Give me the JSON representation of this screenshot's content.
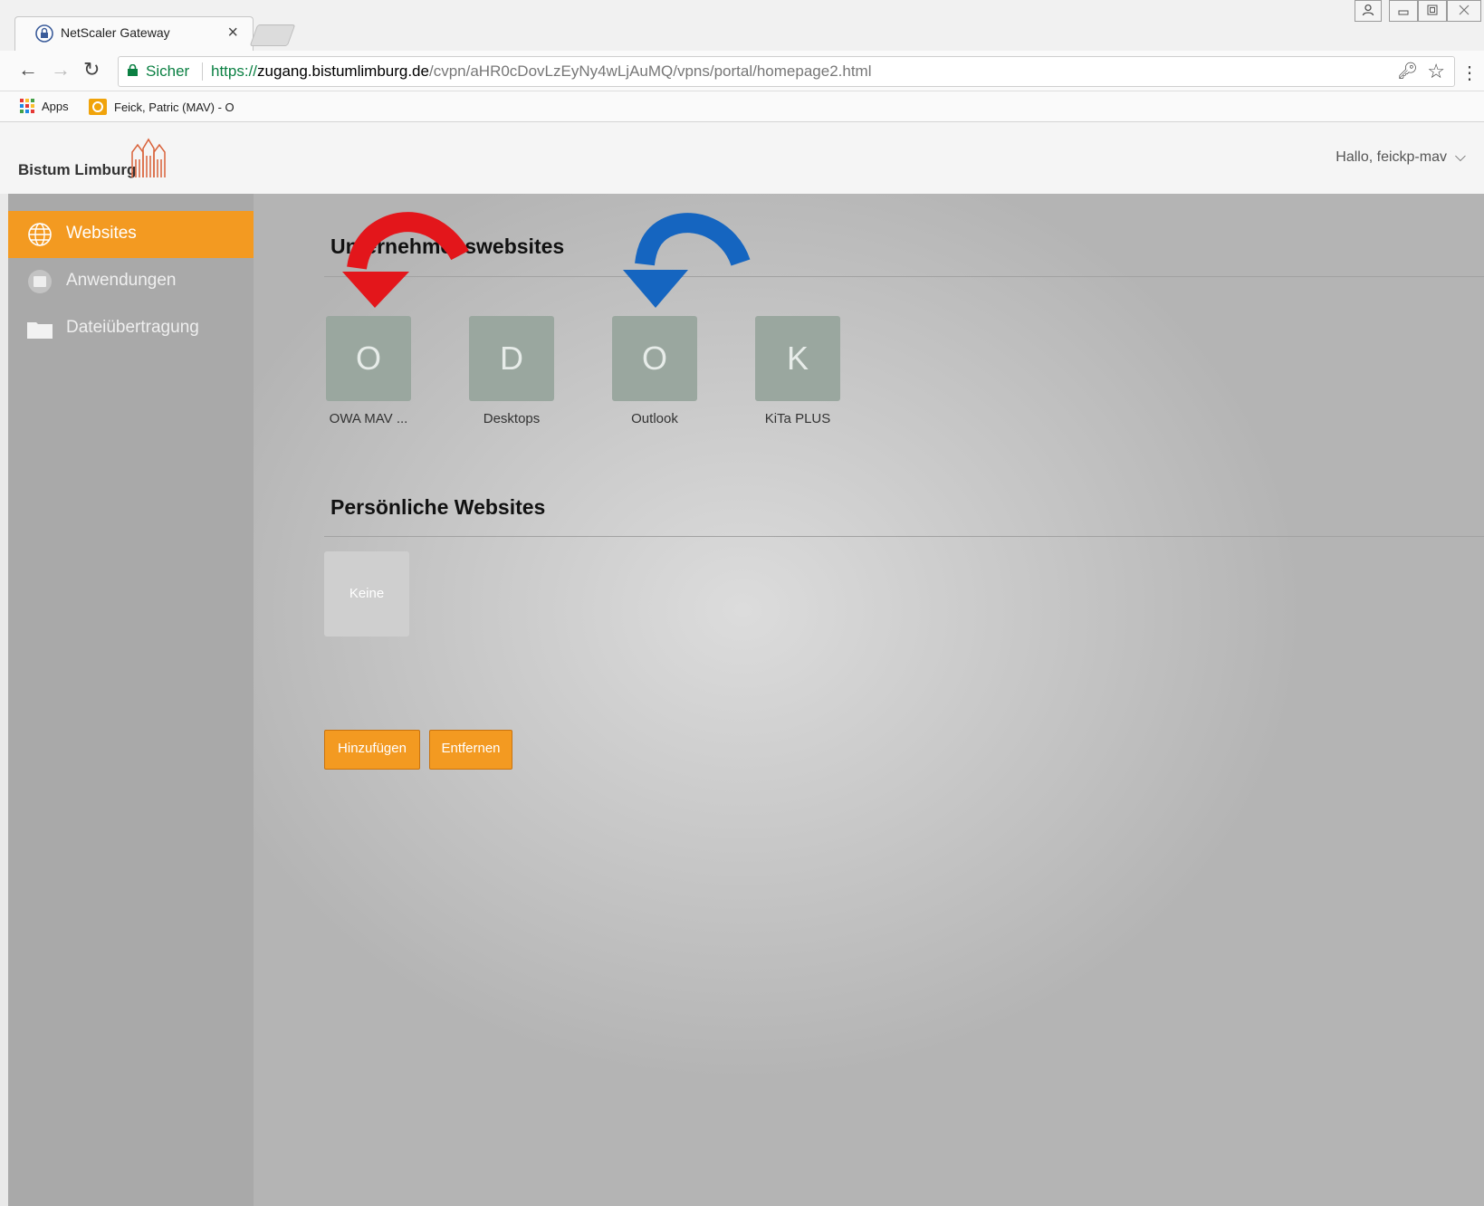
{
  "browser": {
    "tab_title": "NetScaler Gateway",
    "tab_close": "×",
    "secure_label": "Sicher",
    "url_protocol": "https://",
    "url_host": "zugang.bistumlimburg.de",
    "url_path": "/cvpn/aHR0cDovLzEyNy4wLjAuMQ/vpns/portal/homepage2.html",
    "bookmarks": [
      {
        "label": "Apps",
        "icon": "apps-grid-icon"
      },
      {
        "label": "Feick, Patric (MAV) - O",
        "icon": "outlook-icon"
      }
    ]
  },
  "header": {
    "logo_text": "Bistum Limburg",
    "user_greeting": "Hallo,  feickp-mav",
    "user_menu_chevron": "⌵"
  },
  "sidebar": {
    "items": [
      {
        "label": "Websites",
        "icon": "globe-icon",
        "active": true
      },
      {
        "label": "Anwendungen",
        "icon": "applications-icon",
        "active": false
      },
      {
        "label": "Dateiübertragung",
        "icon": "folder-icon",
        "active": false
      }
    ]
  },
  "main": {
    "enterprise_section": {
      "title": "Unternehmenswebsites",
      "tiles": [
        {
          "letter": "O",
          "label": "OWA MAV ..."
        },
        {
          "letter": "D",
          "label": "Desktops"
        },
        {
          "letter": "O",
          "label": "Outlook"
        },
        {
          "letter": "K",
          "label": "KiTa PLUS"
        }
      ]
    },
    "personal_section": {
      "title": "Persönliche Websites",
      "empty_label": "Keine"
    },
    "buttons": {
      "add_label": "Hinzufügen",
      "remove_label": "Entfernen"
    }
  },
  "colors": {
    "accent": "#f39a21",
    "tile": "#9aa79f",
    "sidebar": "#a9a9a9",
    "red_arrow": "#e3161b",
    "blue_arrow": "#1565c0"
  }
}
